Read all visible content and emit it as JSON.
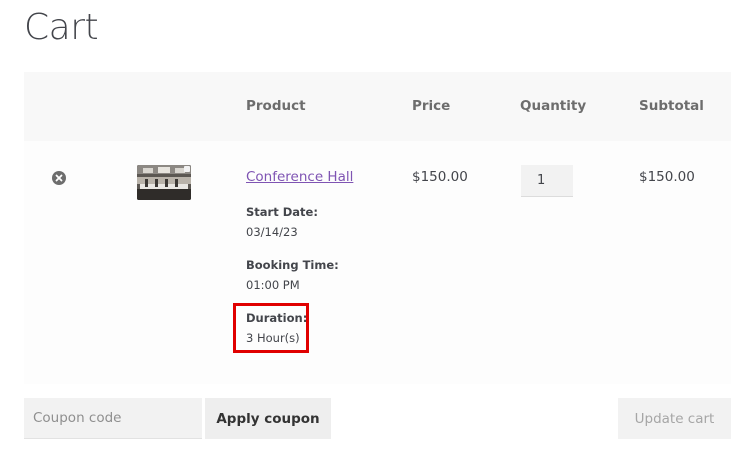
{
  "page": {
    "title": "Cart"
  },
  "table": {
    "headers": {
      "product": "Product",
      "price": "Price",
      "quantity": "Quantity",
      "subtotal": "Subtotal"
    }
  },
  "item": {
    "remove_icon": "remove-circle-x-icon",
    "thumbnail_icon": "conference-room-photo",
    "name": "Conference Hall",
    "meta": {
      "start_date_label": "Start Date:",
      "start_date_value": "03/14/23",
      "booking_time_label": "Booking Time:",
      "booking_time_value": "01:00 PM",
      "duration_label": "Duration:",
      "duration_value": "3 Hour(s)"
    },
    "price": "$150.00",
    "quantity": "1",
    "subtotal": "$150.00"
  },
  "actions": {
    "coupon_placeholder": "Coupon code",
    "apply_coupon_label": "Apply coupon",
    "update_cart_label": "Update cart"
  },
  "colors": {
    "link": "#7f54b3",
    "highlight": "#e00000",
    "header_bg": "#f8f8f8"
  }
}
